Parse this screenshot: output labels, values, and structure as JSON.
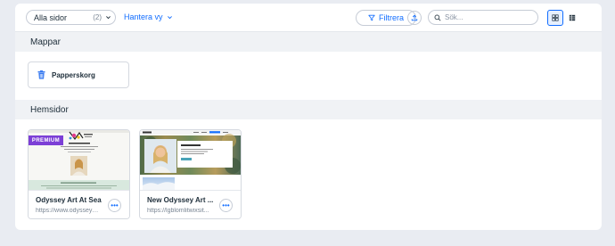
{
  "toolbar": {
    "view_select_label": "Alla sidor",
    "view_select_count": "(2)",
    "manage_label": "Hantera vy",
    "filter_label": "Filtrera",
    "search_placeholder": "Sök..."
  },
  "sections": {
    "folders_title": "Mappar",
    "pages_title": "Hemsidor"
  },
  "folders": [
    {
      "name": "Papperskorg",
      "icon": "trash-icon"
    }
  ],
  "pages": [
    {
      "title": "Odyssey Art At Sea",
      "url": "https://www.odysseya...",
      "badge": "PREMIUM"
    },
    {
      "title": "New Odyssey Art ...",
      "url": "https://lgblomlitwixsit...",
      "badge": ""
    }
  ],
  "colors": {
    "accent": "#116dff",
    "premium": "#7c3fd6",
    "background": "#e9ecf2",
    "section_header": "#f0f2f5"
  }
}
